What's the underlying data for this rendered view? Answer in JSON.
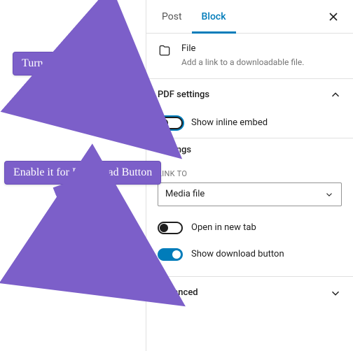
{
  "tabs": {
    "post": "Post",
    "block": "Block"
  },
  "block": {
    "title": "File",
    "description": "Add a link to a downloadable file."
  },
  "pdf": {
    "heading": "PDF settings",
    "show_inline_embed": "Show inline embed"
  },
  "settings": {
    "heading": "Settings",
    "link_to_label": "Link to",
    "link_to_value": "Media file",
    "open_new_tab": "Open in new tab",
    "show_download": "Show download button"
  },
  "advanced": {
    "heading": "Advanced"
  },
  "callouts": {
    "turn_off": "Turn OFF",
    "enable_download": "Enable it for Download Button"
  }
}
